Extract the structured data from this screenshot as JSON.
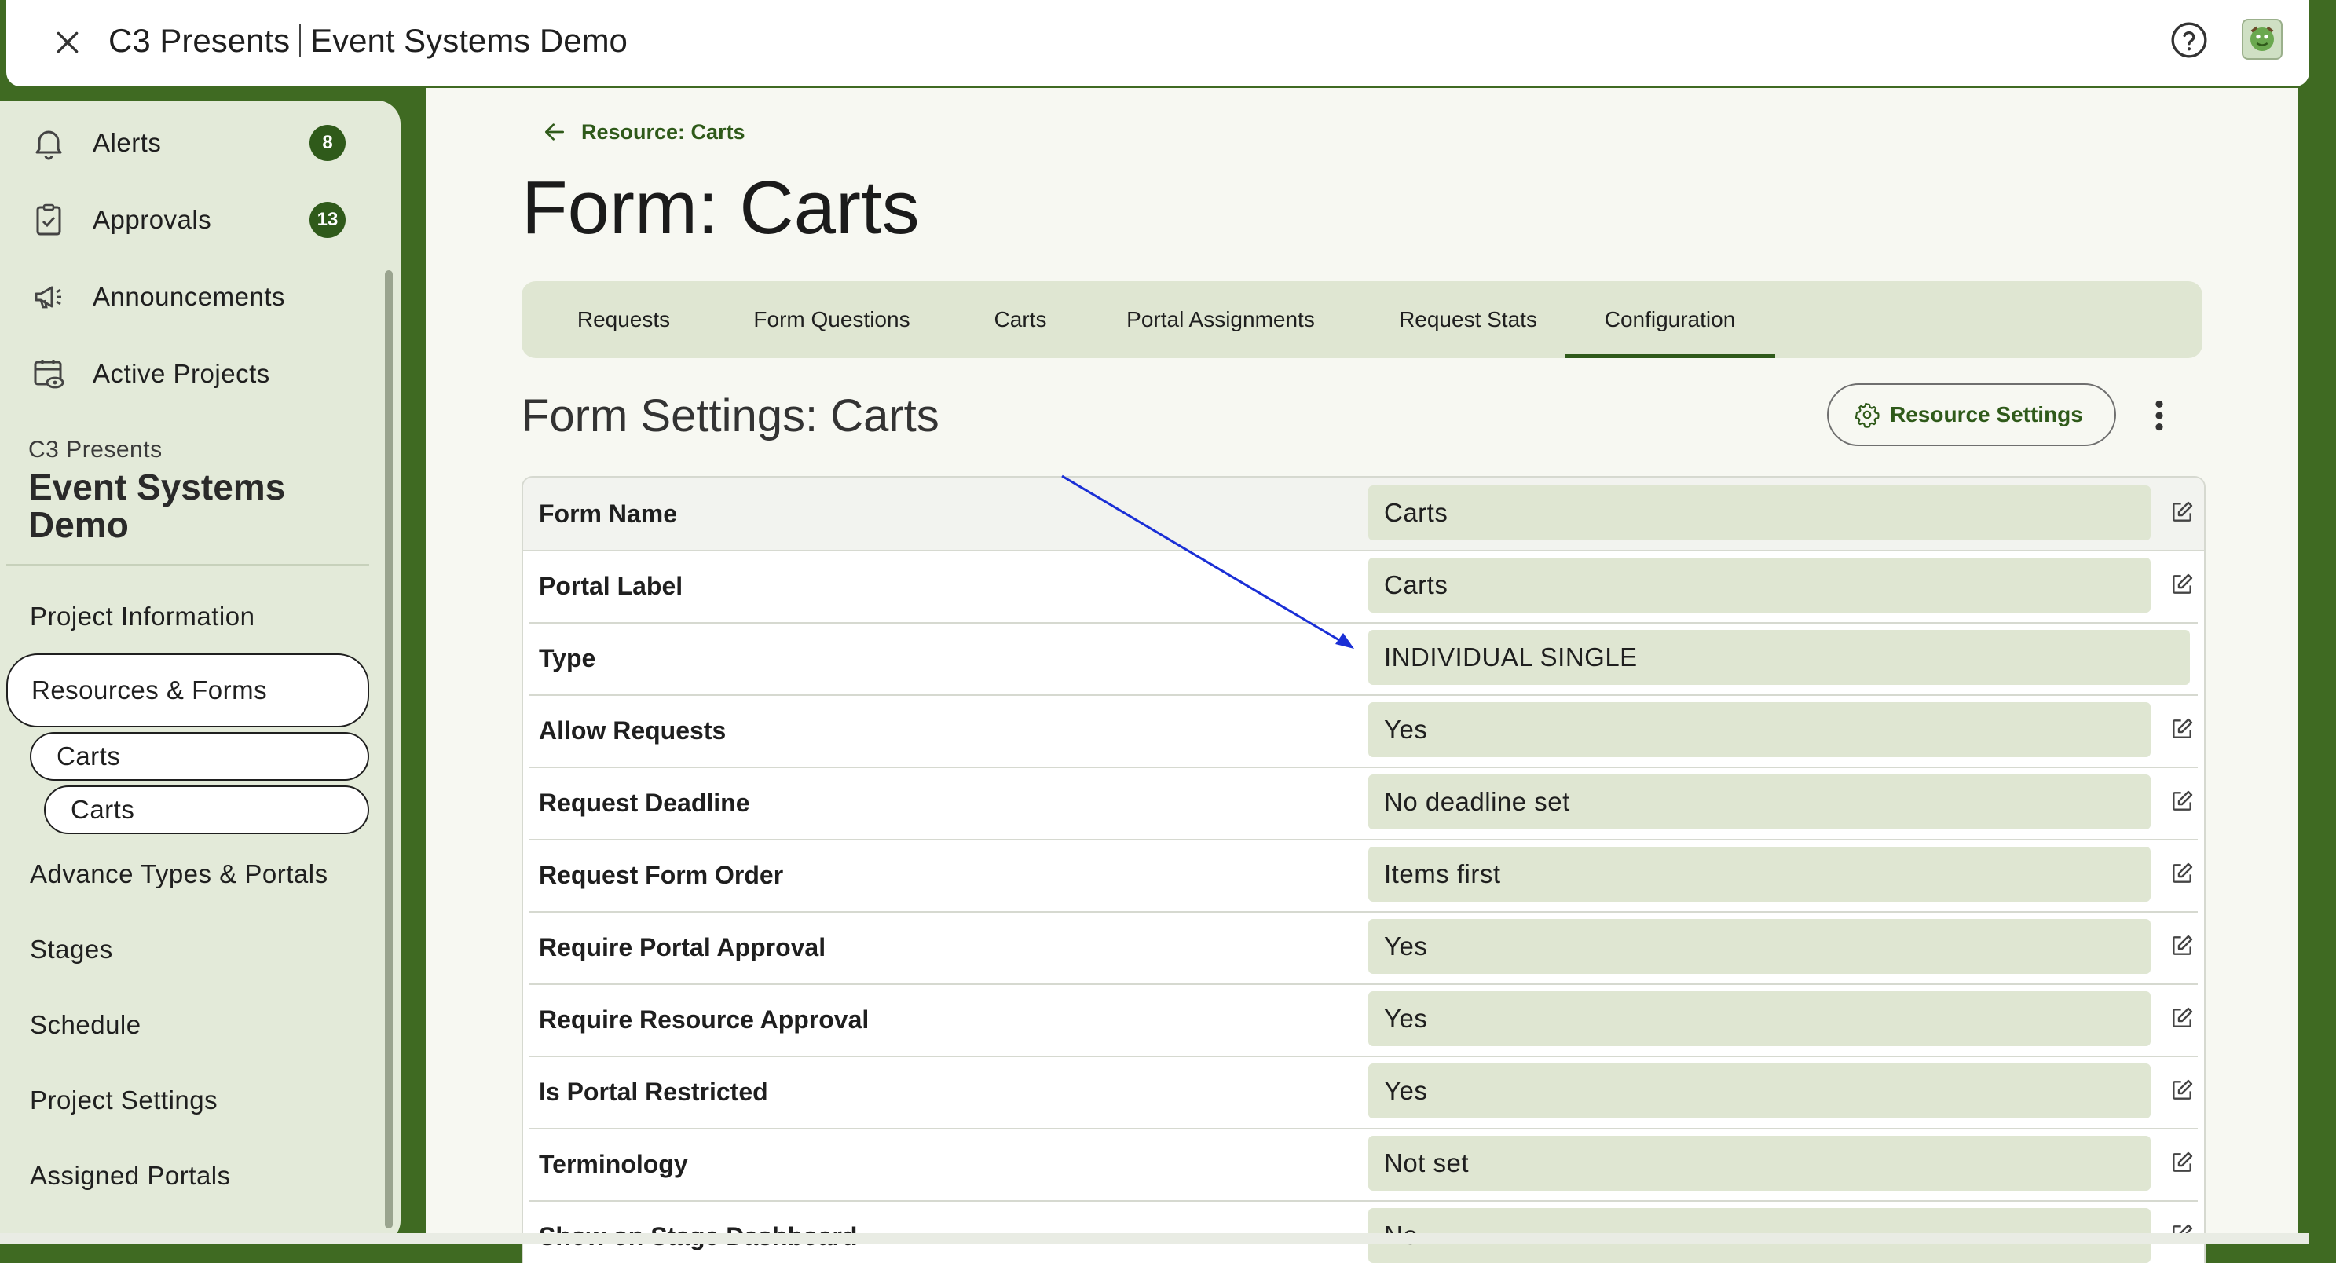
{
  "topbar": {
    "org": "C3 Presents",
    "project": "Event Systems Demo"
  },
  "sidebar": {
    "nav": [
      {
        "label": "Alerts",
        "badge": "8",
        "icon": "bell-icon"
      },
      {
        "label": "Approvals",
        "badge": "13",
        "icon": "clipboard-check-icon"
      },
      {
        "label": "Announcements",
        "icon": "megaphone-icon"
      },
      {
        "label": "Active Projects",
        "icon": "calendar-eye-icon"
      }
    ],
    "org_label": "C3 Presents",
    "project_label": "Event Systems Demo",
    "links": {
      "project_information": "Project Information",
      "resources_forms": "Resources & Forms",
      "carts_1": "Carts",
      "carts_2": "Carts",
      "advance_types": "Advance Types & Portals",
      "stages": "Stages",
      "schedule": "Schedule",
      "project_settings": "Project Settings",
      "assigned_portals": "Assigned Portals"
    }
  },
  "main": {
    "back_label": "Resource: Carts",
    "title": "Form: Carts",
    "tabs": [
      "Requests",
      "Form Questions",
      "Carts",
      "Portal Assignments",
      "Request Stats",
      "Configuration"
    ],
    "active_tab": "Configuration",
    "section_title": "Form Settings: Carts",
    "resource_settings_label": "Resource Settings",
    "settings": [
      {
        "key": "Form Name",
        "value": "Carts",
        "editable": true
      },
      {
        "key": "Portal Label",
        "value": "Carts",
        "editable": true
      },
      {
        "key": "Type",
        "value": "INDIVIDUAL SINGLE",
        "editable": false
      },
      {
        "key": "Allow Requests",
        "value": "Yes",
        "editable": true
      },
      {
        "key": "Request Deadline",
        "value": "No deadline set",
        "editable": true
      },
      {
        "key": "Request Form Order",
        "value": "Items first",
        "editable": true
      },
      {
        "key": "Require Portal Approval",
        "value": "Yes",
        "editable": true
      },
      {
        "key": "Require Resource Approval",
        "value": "Yes",
        "editable": true
      },
      {
        "key": "Is Portal Restricted",
        "value": "Yes",
        "editable": true
      },
      {
        "key": "Terminology",
        "value": "Not set",
        "editable": true
      },
      {
        "key": "Show on Stage Dashboard",
        "value": "No",
        "editable": true
      }
    ]
  },
  "colors": {
    "brand_green": "#2f5a1a",
    "background_green": "#3f6a22",
    "panel_tint": "#dfe6d2",
    "annotation_arrow": "#1a2fd6"
  }
}
